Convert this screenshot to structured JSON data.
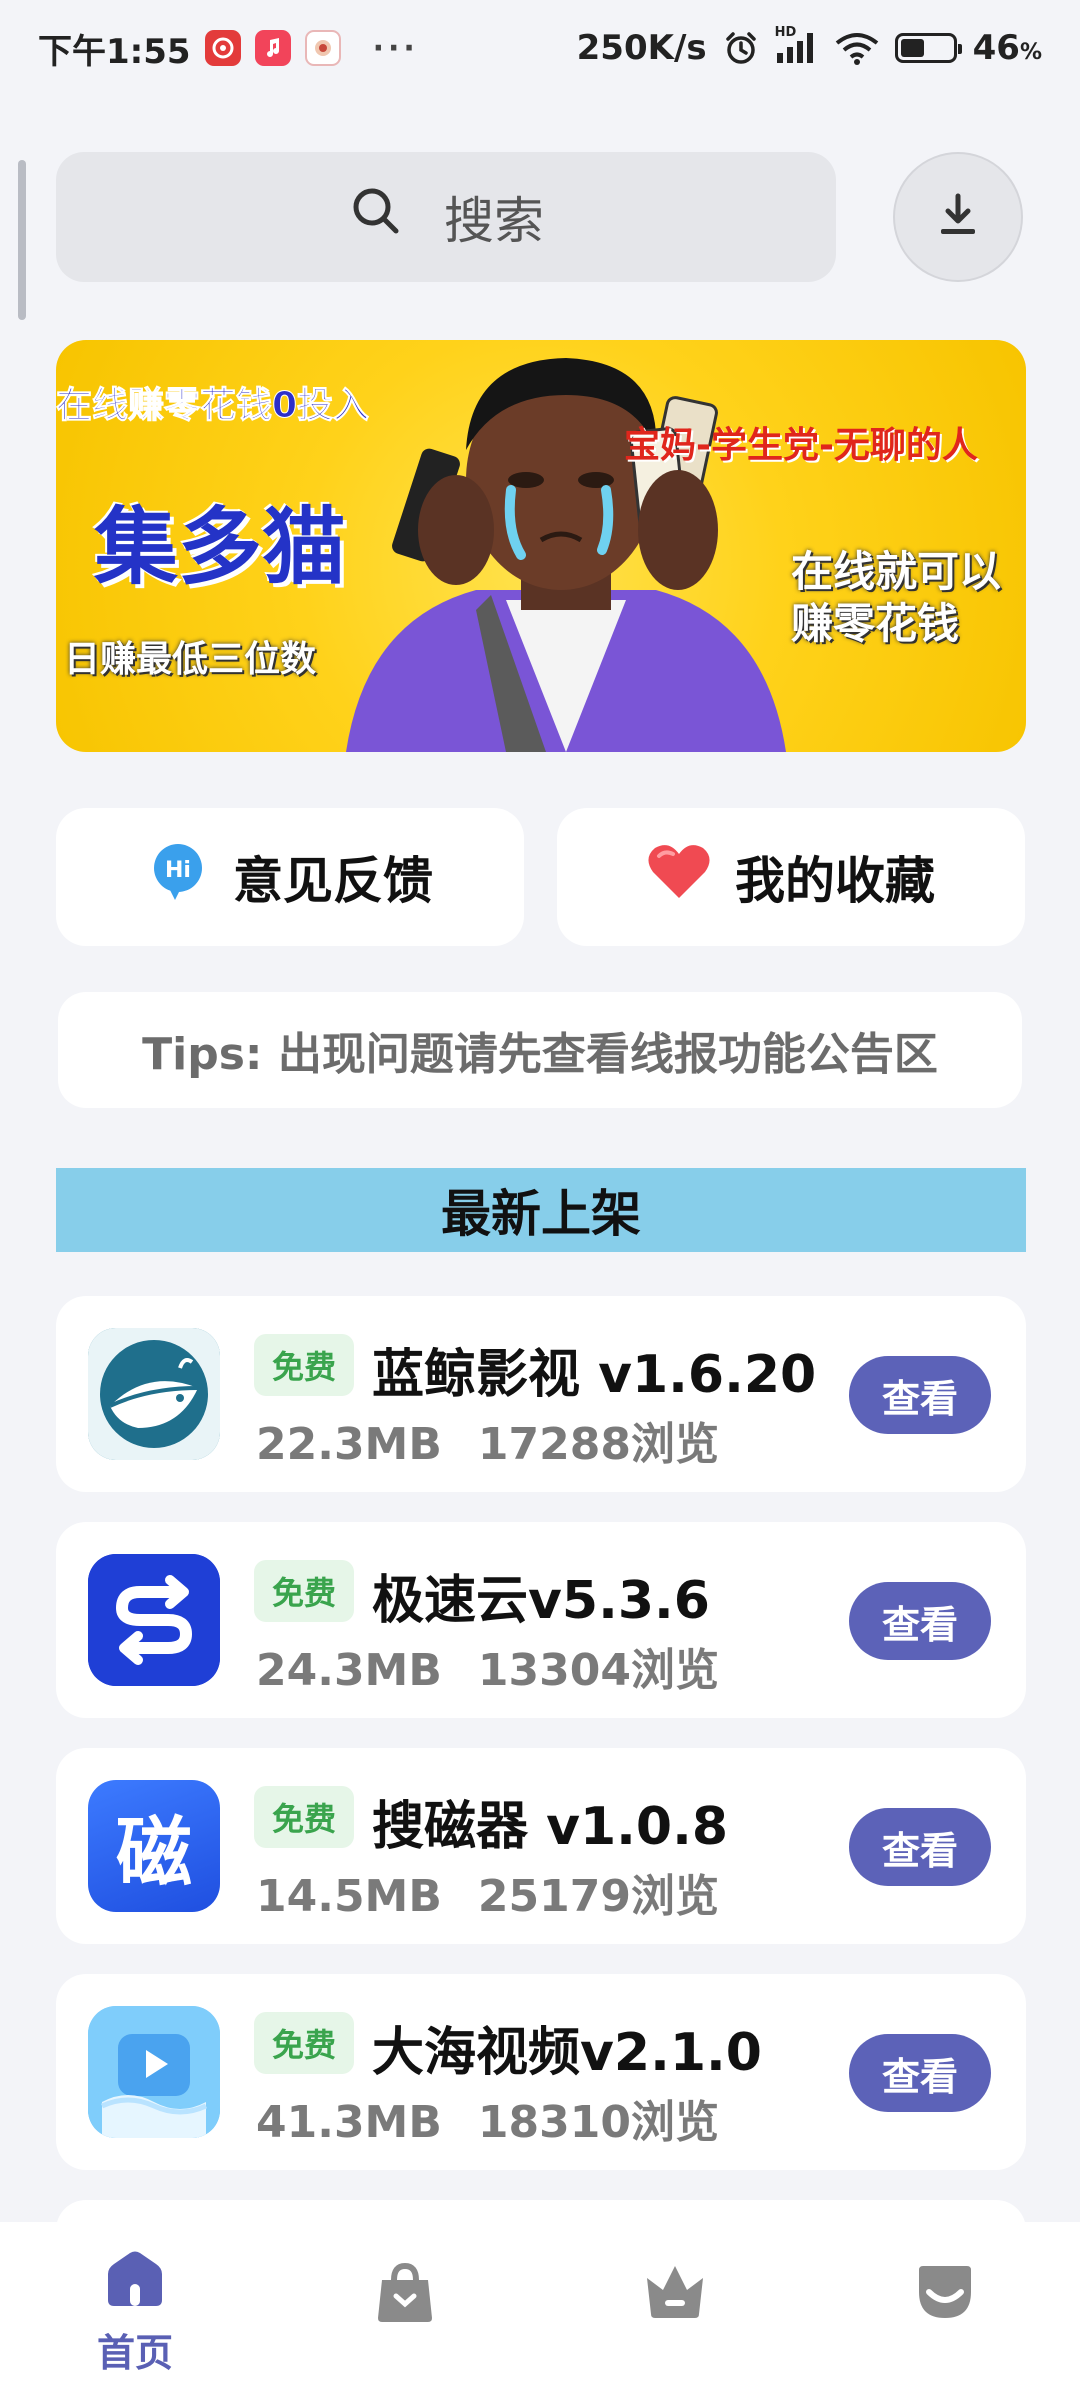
{
  "status_bar": {
    "time": "下午1:55",
    "net_speed": "250K/s",
    "battery": "46",
    "battery_unit": "%",
    "hd_label": "HD",
    "more": "···"
  },
  "search": {
    "placeholder": "搜索"
  },
  "banner": {
    "line_top": "在线赚零花钱0投入",
    "brand": "集多猫",
    "daily": "日赚最低三位数",
    "audience": "宝妈-学生党-无聊的人",
    "online": "在线就可以赚零花钱"
  },
  "quick_actions": {
    "feedback": "意见反馈",
    "feedback_icon_text": "Hi",
    "favorites": "我的收藏"
  },
  "tips": "Tips: 出现问题请先查看线报功能公告区",
  "section_title": "最新上架",
  "apps": [
    {
      "badge": "免费",
      "name": "蓝鲸影视 v1.6.20",
      "size": "22.3MB",
      "views": "17288浏览",
      "action": "查看"
    },
    {
      "badge": "免费",
      "name": "极速云v5.3.6",
      "size": "24.3MB",
      "views": "13304浏览",
      "action": "查看"
    },
    {
      "badge": "免费",
      "name": "搜磁器 v1.0.8",
      "size": "14.5MB",
      "views": "25179浏览",
      "action": "查看",
      "icon_text": "磁"
    },
    {
      "badge": "免费",
      "name": "大海视频v2.1.0",
      "size": "41.3MB",
      "views": "18310浏览",
      "action": "查看"
    }
  ],
  "bottom_nav": {
    "home": "首页",
    "active": "home"
  },
  "colors": {
    "accent": "#5c62b8",
    "section_bg": "#87ceea",
    "badge_bg": "#e6f6e8",
    "badge_text": "#3aa44d",
    "banner_yellow": "#ffd21a"
  }
}
